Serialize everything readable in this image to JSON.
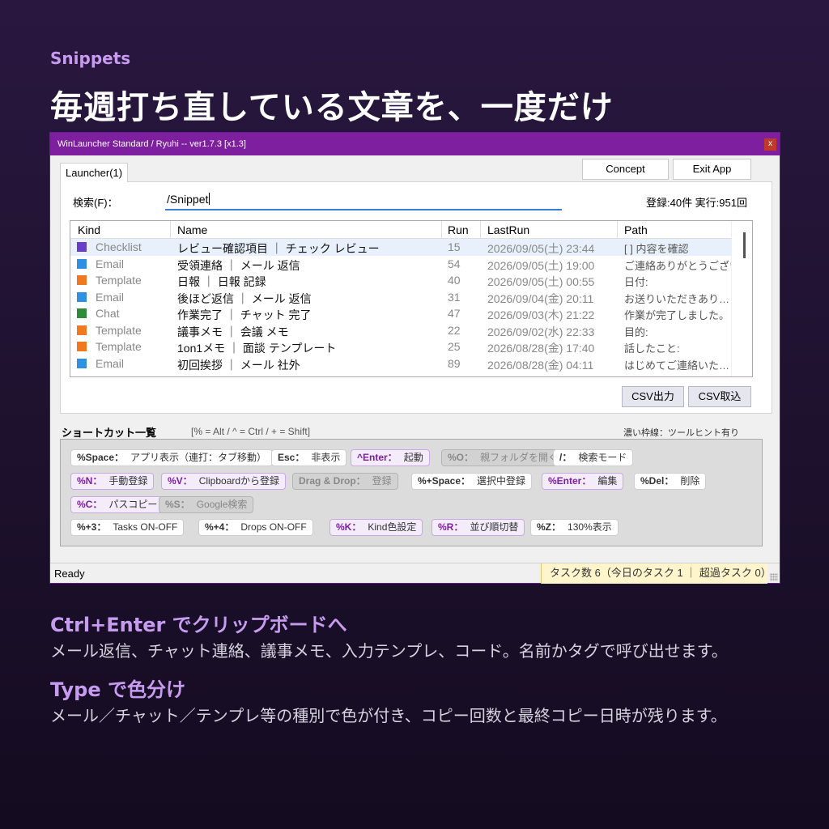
{
  "page": {
    "eyebrow": "Snippets",
    "headline": "毎週打ち直している文章を、一度だけ",
    "section1_title": "Ctrl+Enter でクリップボードへ",
    "section1_desc": "メール返信、チャット連絡、議事メモ、入力テンプレ、コード。名前かタグで呼び出せます。",
    "section2_title": "Type で色分け",
    "section2_desc": "メール／チャット／テンプレ等の種別で色が付き、コピー回数と最終コピー日時が残ります。"
  },
  "window": {
    "title": "WinLauncher Standard / Ryuhi -- ver1.7.3 [x1.3]",
    "close_label": "x",
    "tab_label": "Launcher(1)",
    "concept_button": "Concept",
    "exit_button": "Exit App",
    "search_label": "検索(F)：",
    "search_value": "/Snippet",
    "stats": "登録:40件 実行:951回",
    "columns": {
      "kind": "Kind",
      "name": "Name",
      "run": "Run",
      "lastrun": "LastRun",
      "path": "Path"
    },
    "rows": [
      {
        "kind": "Checklist",
        "color": "#6a3dc9",
        "name": "レビュー確認項目 ｜ チェック レビュー",
        "run": "15",
        "lastrun": "2026/09/05(土) 23:44",
        "path": "[ ] 内容を確認"
      },
      {
        "kind": "Email",
        "color": "#2f8fe0",
        "name": "受領連絡 ｜ メール 返信",
        "run": "54",
        "lastrun": "2026/09/05(土) 19:00",
        "path": "ご連絡ありがとうございま"
      },
      {
        "kind": "Template",
        "color": "#f07820",
        "name": "日報 ｜ 日報 記録",
        "run": "40",
        "lastrun": "2026/09/05(土) 00:55",
        "path": "日付:"
      },
      {
        "kind": "Email",
        "color": "#2f8fe0",
        "name": "後ほど返信 ｜ メール 返信",
        "run": "31",
        "lastrun": "2026/09/04(金) 20:11",
        "path": "お送りいただきあり…"
      },
      {
        "kind": "Chat",
        "color": "#2e8b3a",
        "name": "作業完了 ｜ チャット 完了",
        "run": "47",
        "lastrun": "2026/09/03(木) 21:22",
        "path": "作業が完了しました。"
      },
      {
        "kind": "Template",
        "color": "#f07820",
        "name": "議事メモ ｜ 会議 メモ",
        "run": "22",
        "lastrun": "2026/09/02(水) 22:33",
        "path": "目的:"
      },
      {
        "kind": "Template",
        "color": "#f07820",
        "name": "1on1メモ ｜ 面談 テンプレート",
        "run": "25",
        "lastrun": "2026/08/28(金) 17:40",
        "path": "話したこと:"
      },
      {
        "kind": "Email",
        "color": "#2f8fe0",
        "name": "初回挨拶 ｜ メール 社外",
        "run": "89",
        "lastrun": "2026/08/28(金) 04:11",
        "path": "はじめてご連絡いた…"
      }
    ],
    "csv_export": "CSV出力",
    "csv_import": "CSV取込",
    "shortcuts_title": "ショートカット一覧",
    "shortcuts_legend": "[% = Alt / ^ = Ctrl / + = Shift]",
    "shortcuts_hint": "濃い枠線：ツールヒント有り",
    "shortcuts": [
      {
        "key": "%Space：",
        "desc": "アプリ表示（連打：タブ移動）",
        "style": "n"
      },
      {
        "key": "Esc：",
        "desc": "非表示",
        "style": "n"
      },
      {
        "key": "^Enter：",
        "desc": "起動",
        "style": "p"
      },
      {
        "key": "%O：",
        "desc": "親フォルダを開く",
        "style": "g"
      },
      {
        "key": "/：",
        "desc": "検索モード",
        "style": "n"
      },
      {
        "key": "%N：",
        "desc": "手動登録",
        "style": "p"
      },
      {
        "key": "%V：",
        "desc": "Clipboardから登録",
        "style": "p"
      },
      {
        "key": "Drag & Drop：",
        "desc": "登録",
        "style": "g"
      },
      {
        "key": "%+Space：",
        "desc": "選択中登録",
        "style": "n"
      },
      {
        "key": "%Enter：",
        "desc": "編集",
        "style": "p"
      },
      {
        "key": "%Del：",
        "desc": "削除",
        "style": "n"
      },
      {
        "key": "%C：",
        "desc": "パスコピー",
        "style": "p"
      },
      {
        "key": "%S：",
        "desc": "Google検索",
        "style": "g"
      },
      {
        "key": "%+3：",
        "desc": "Tasks ON-OFF",
        "style": "n"
      },
      {
        "key": "%+4：",
        "desc": "Drops ON-OFF",
        "style": "n"
      },
      {
        "key": "%K：",
        "desc": "Kind色設定",
        "style": "p"
      },
      {
        "key": "%R：",
        "desc": "並び順切替",
        "style": "p"
      },
      {
        "key": "%Z：",
        "desc": "130%表示",
        "style": "n"
      }
    ],
    "status_left": "Ready",
    "status_right": "タスク数 6（今日のタスク 1 ｜ 超過タスク 0）"
  }
}
